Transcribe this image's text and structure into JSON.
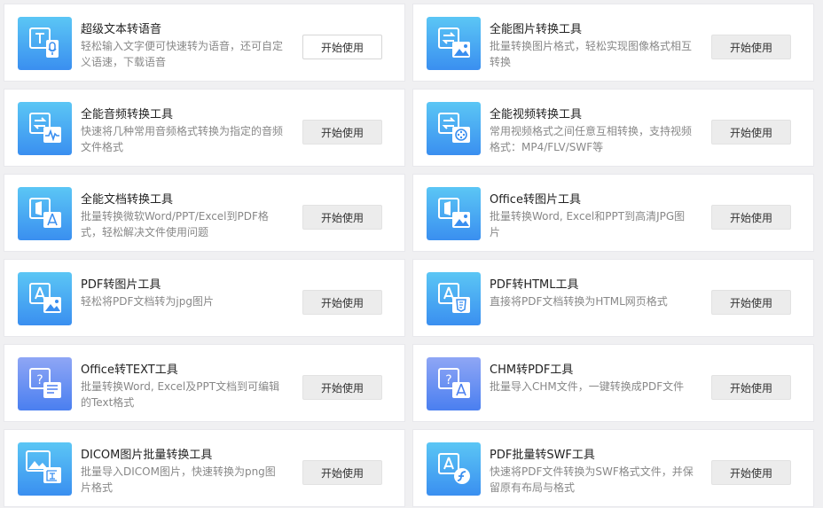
{
  "tools": [
    {
      "title": "超级文本转语音",
      "desc": "轻松输入文字便可快速转为语音，还可自定义语速，下载语音",
      "button": "开始使用",
      "icon": "text-to-speech-icon"
    },
    {
      "title": "全能图片转换工具",
      "desc": "批量转换图片格式，轻松实现图像格式相互转换",
      "button": "开始使用",
      "icon": "image-convert-icon"
    },
    {
      "title": "全能音频转换工具",
      "desc": "快速将几种常用音频格式转换为指定的音频文件格式",
      "button": "开始使用",
      "icon": "audio-convert-icon"
    },
    {
      "title": "全能视频转换工具",
      "desc": "常用视频格式之间任意互相转换，支持视频格式：MP4/FLV/SWF等",
      "button": "开始使用",
      "icon": "video-convert-icon"
    },
    {
      "title": "全能文档转换工具",
      "desc": "批量转换微软Word/PPT/Excel到PDF格式，轻松解决文件使用问题",
      "button": "开始使用",
      "icon": "document-convert-icon"
    },
    {
      "title": "Office转图片工具",
      "desc": "批量转换Word, Excel和PPT到高清JPG图片",
      "button": "开始使用",
      "icon": "office-to-image-icon"
    },
    {
      "title": "PDF转图片工具",
      "desc": "轻松将PDF文档转为jpg图片",
      "button": "开始使用",
      "icon": "pdf-to-image-icon"
    },
    {
      "title": "PDF转HTML工具",
      "desc": "直接将PDF文档转换为HTML网页格式",
      "button": "开始使用",
      "icon": "pdf-to-html-icon"
    },
    {
      "title": "Office转TEXT工具",
      "desc": "批量转换Word, Excel及PPT文档到可编辑的Text格式",
      "button": "开始使用",
      "icon": "office-to-text-icon"
    },
    {
      "title": "CHM转PDF工具",
      "desc": "批量导入CHM文件，一键转换成PDF文件",
      "button": "开始使用",
      "icon": "chm-to-pdf-icon"
    },
    {
      "title": "DICOM图片批量转换工具",
      "desc": "批量导入DICOM图片，快速转换为png图片格式",
      "button": "开始使用",
      "icon": "dicom-convert-icon"
    },
    {
      "title": "PDF批量转SWF工具",
      "desc": "快速将PDF文件转换为SWF格式文件，并保留原有布局与格式",
      "button": "开始使用",
      "icon": "pdf-to-swf-icon"
    }
  ],
  "colors": {
    "icon_top": "#5bc6f5",
    "icon_bottom": "#3a8ff0",
    "button_bg": "#ececec",
    "title": "#222222",
    "desc": "#888888"
  }
}
